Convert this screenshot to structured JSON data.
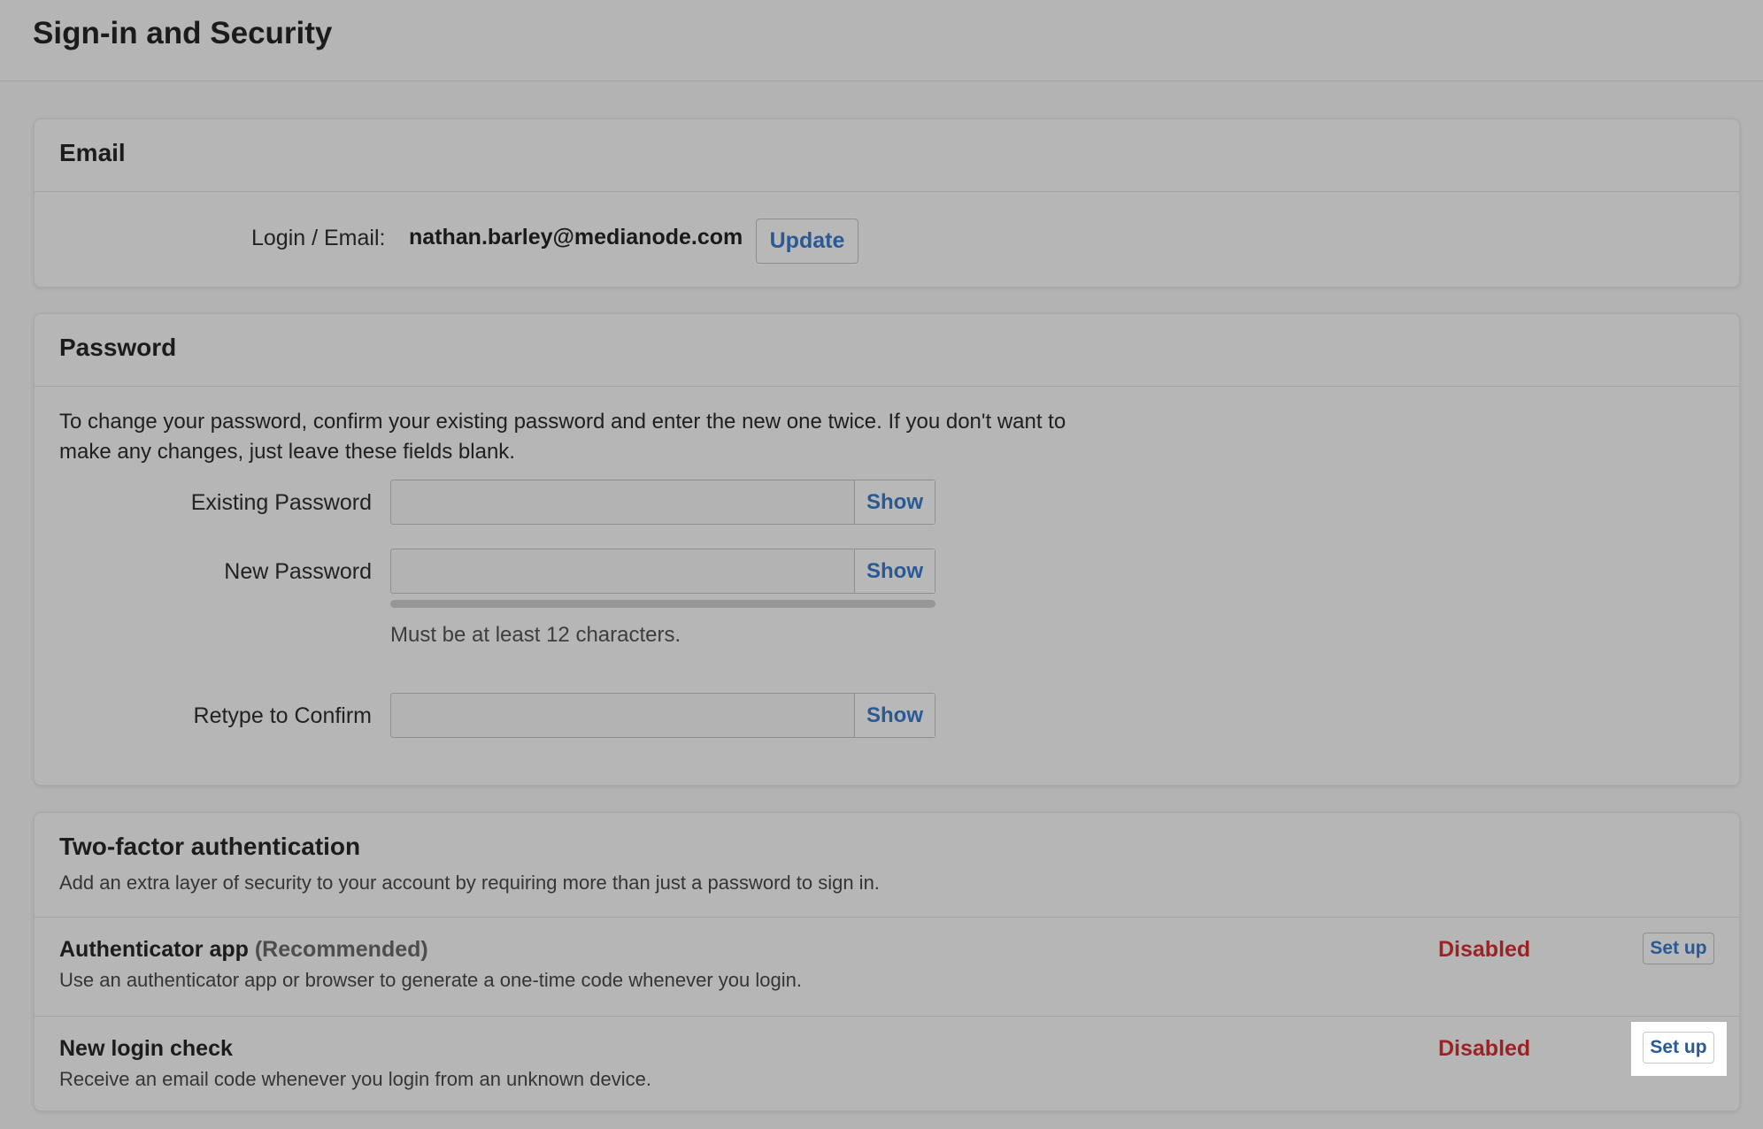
{
  "page": {
    "title": "Sign-in and Security"
  },
  "email": {
    "section_title": "Email",
    "login_label": "Login / Email:",
    "login_value": "nathan.barley@medianode.com",
    "update_label": "Update"
  },
  "password": {
    "section_title": "Password",
    "intro_line1": "To change your password, confirm your existing password and enter the new one twice. If you don't want to",
    "intro_line2": "make any changes, just leave these fields blank.",
    "fields": [
      {
        "label": "Existing Password",
        "value": "",
        "show_label": "Show"
      },
      {
        "label": "New Password",
        "value": "",
        "show_label": "Show"
      },
      {
        "label": "Retype to Confirm",
        "value": "",
        "show_label": "Show"
      }
    ],
    "hint": "Must be at least 12 characters.",
    "strength": 0
  },
  "two_factor": {
    "section_title": "Two-factor authentication",
    "description": "Add an extra layer of security to your account by requiring more than just a password to sign in.",
    "methods": [
      {
        "title": "Authenticator app",
        "tag": "(Recommended)",
        "description": "Use an authenticator app or browser to generate a one-time code whenever you login.",
        "status": "Disabled",
        "action_label": "Set up"
      },
      {
        "title": "New login check",
        "tag": "",
        "description": "Receive an email code whenever you login from an unknown device.",
        "status": "Disabled",
        "action_label": "Set up"
      }
    ]
  },
  "colors": {
    "link_blue": "#2a5a94",
    "status_red": "#9b2323",
    "background_gray": "#b3b3b3"
  }
}
